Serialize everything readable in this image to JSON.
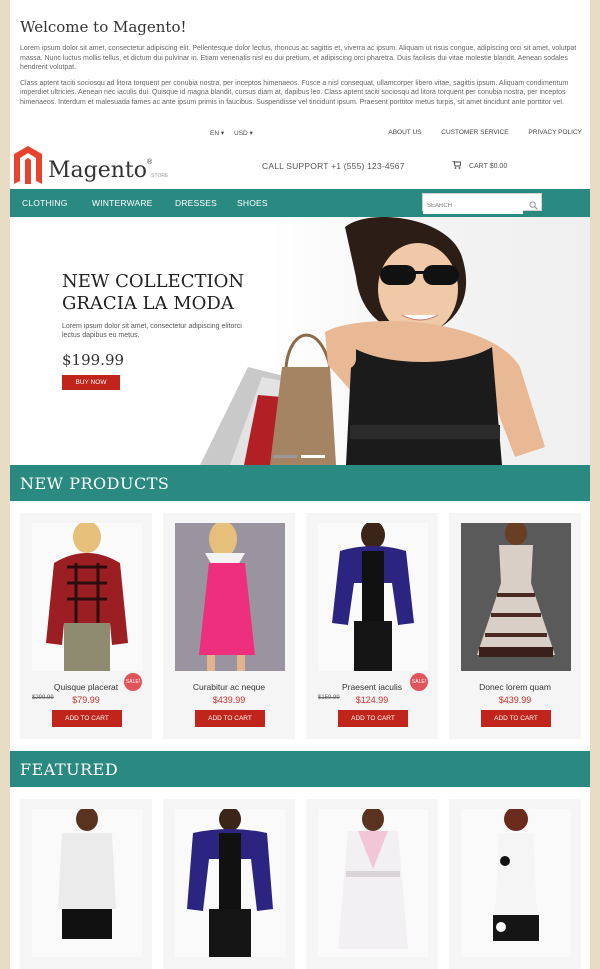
{
  "welcome": {
    "title": "Welcome to Magento!",
    "p1": "Lorem ipsum dolor sit amet, consectetur adipiscing elit. Pellentesque dolor lectus, rhoncus ac sagittis et, viverra ac ipsum. Aliquam ut risus congue, adipiscing orci sit amet, volutpat massa. Nunc luctus mollis tellus, et dictum dui pulvinar in. Etiam venenatis nisl eu dui pretium, et adipiscing orci pharetra. Duis facilisis dui vitae molestie blandit. Aenean sodales hendrerit volutpat.",
    "p2": "Class aptent taciti sociosqu ad litora torquent per conubia nostra, per inceptos himenaeos. Fusce a nisl consequat, ullamcorper libero vitae, sagittis ipsum. Aliquam condimentum imperdiet ultricies. Aenean nec iaculis dui. Quisque id magna blandit, cursus diam at, dapibus leo. Class aptent taciti sociosqu ad litora torquent per conubia nostra, per inceptos himenaeos. Interdum et malesuada fames ac ante ipsum primis in faucibus. Suspendisse vel tincidunt ipsum. Praesent porttitor metus turpis, sit amet tincidunt ante porttitor vel."
  },
  "topbar": {
    "language": "EN",
    "currency": "USD",
    "links": [
      "ABOUT US",
      "CUSTOMER SERVICE",
      "PRIVACY POLICY"
    ]
  },
  "brand": {
    "logo_text": "Magento",
    "logo_sub": "STORE",
    "call": "CALL SUPPORT +1 (555) 123-4567",
    "cart": "CART $0.00"
  },
  "nav": {
    "items": [
      "CLOTHING",
      "WINTERWARE",
      "DRESSES",
      "SHOES"
    ],
    "search_placeholder": "SEARCH"
  },
  "banner": {
    "line1": "NEW COLLECTION",
    "line2": "GRACIA LA MODA",
    "desc": "Lorem ipsum dolor sit amet, consectetur adipiscing elitorci lectus dapibus eu metus.",
    "price": "$199.99",
    "button": "BUY NOW"
  },
  "new_products": {
    "title": "NEW PRODUCTS",
    "items": [
      {
        "name": "Quisque placerat",
        "old_price": "$299.99",
        "price": "$79.99",
        "sale": "SALE!",
        "button": "ADD TO CART"
      },
      {
        "name": "Curabitur ac neque",
        "price": "$439.99",
        "button": "ADD TO CART"
      },
      {
        "name": "Praesent iaculis",
        "old_price": "$159.99",
        "price": "$124.99",
        "sale": "SALE!",
        "button": "ADD TO CART"
      },
      {
        "name": "Donec lorem quam",
        "price": "$439.99",
        "button": "ADD TO CART"
      }
    ]
  },
  "featured": {
    "title": "FEATURED"
  },
  "colors": {
    "accent": "#2a8a82",
    "button": "#c0241b",
    "price": "#c8322a",
    "sale_badge": "#e0555a",
    "page_bg": "#e9dcc4"
  }
}
